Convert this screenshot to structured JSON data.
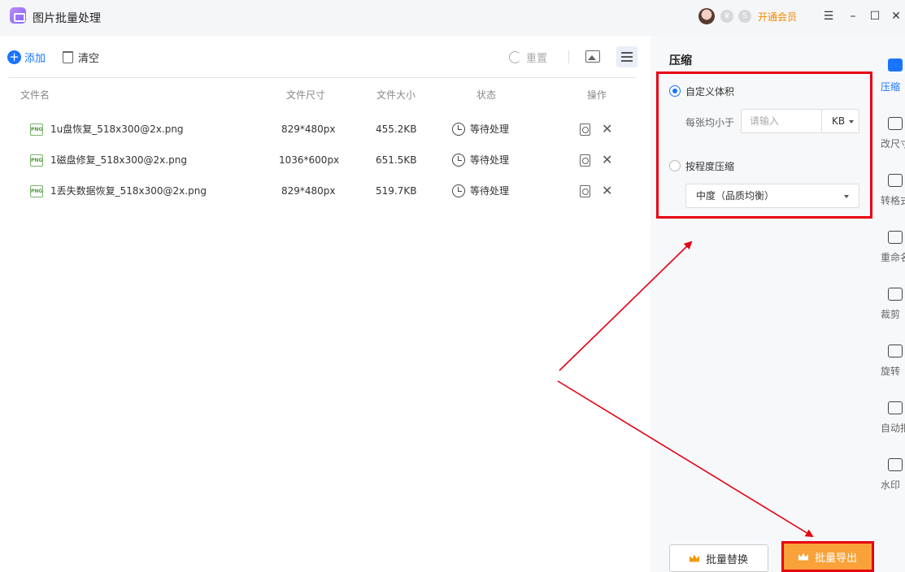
{
  "app": {
    "title": "图片批量处理",
    "vip_label": "开通会员"
  },
  "window_controls": [
    "☰",
    "–",
    "☐",
    "✕"
  ],
  "toolbar": {
    "add_label": "添加",
    "clear_label": "清空",
    "reset_label": "重置"
  },
  "table": {
    "headers": {
      "name": "文件名",
      "dimensions": "文件尺寸",
      "size": "文件大小",
      "status": "状态",
      "actions": "操作"
    },
    "rows": [
      {
        "icon_text": "PNG",
        "name": "1u盘恢复_518x300@2x.png",
        "dimensions": "829*480px",
        "size": "455.2KB",
        "status": "等待处理"
      },
      {
        "icon_text": "PNG",
        "name": "1磁盘修复_518x300@2x.png",
        "dimensions": "1036*600px",
        "size": "651.5KB",
        "status": "等待处理"
      },
      {
        "icon_text": "PNG",
        "name": "1丢失数据恢复_518x300@2x.png",
        "dimensions": "829*480px",
        "size": "519.7KB",
        "status": "等待处理"
      }
    ]
  },
  "compress_panel": {
    "title": "压缩",
    "option_custom": "自定义体积",
    "per_image_label": "每张均小于",
    "input_placeholder": "请输入",
    "unit": "KB",
    "option_level": "按程度压缩",
    "level_value": "中度（品质均衡）"
  },
  "tools": [
    {
      "label": "压缩",
      "active": true
    },
    {
      "label": "改尺寸",
      "active": false
    },
    {
      "label": "转格式",
      "active": false
    },
    {
      "label": "重命名",
      "active": false
    },
    {
      "label": "裁剪",
      "active": false
    },
    {
      "label": "旋转",
      "active": false
    },
    {
      "label": "自动抠图",
      "active": false
    },
    {
      "label": "水印",
      "active": false
    }
  ],
  "buttons": {
    "replace": "批量替换",
    "export": "批量导出"
  },
  "colors": {
    "accent": "#1a74ff",
    "vip": "#f08a00",
    "highlight": "#e60012",
    "export_bg": "#f9a23a"
  }
}
